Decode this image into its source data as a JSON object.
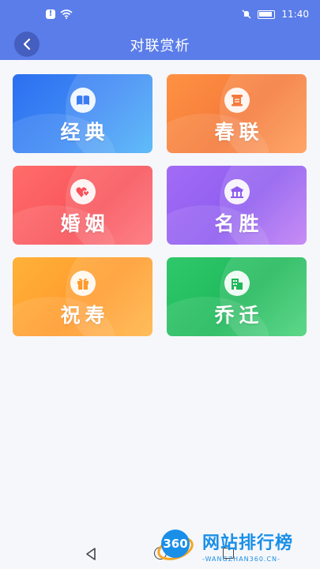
{
  "status_bar": {
    "time": "11:40"
  },
  "header": {
    "title": "对联赏析"
  },
  "categories": [
    {
      "label": "经典",
      "icon": "book-icon"
    },
    {
      "label": "春联",
      "icon": "scroll-icon"
    },
    {
      "label": "婚姻",
      "icon": "hearts-icon"
    },
    {
      "label": "名胜",
      "icon": "temple-icon"
    },
    {
      "label": "祝寿",
      "icon": "gift-icon"
    },
    {
      "label": "乔迁",
      "icon": "building-icon"
    }
  ],
  "watermark": {
    "badge": "360",
    "title": "网站排行榜",
    "subtitle": "-WANGZHAN360.CN-"
  }
}
